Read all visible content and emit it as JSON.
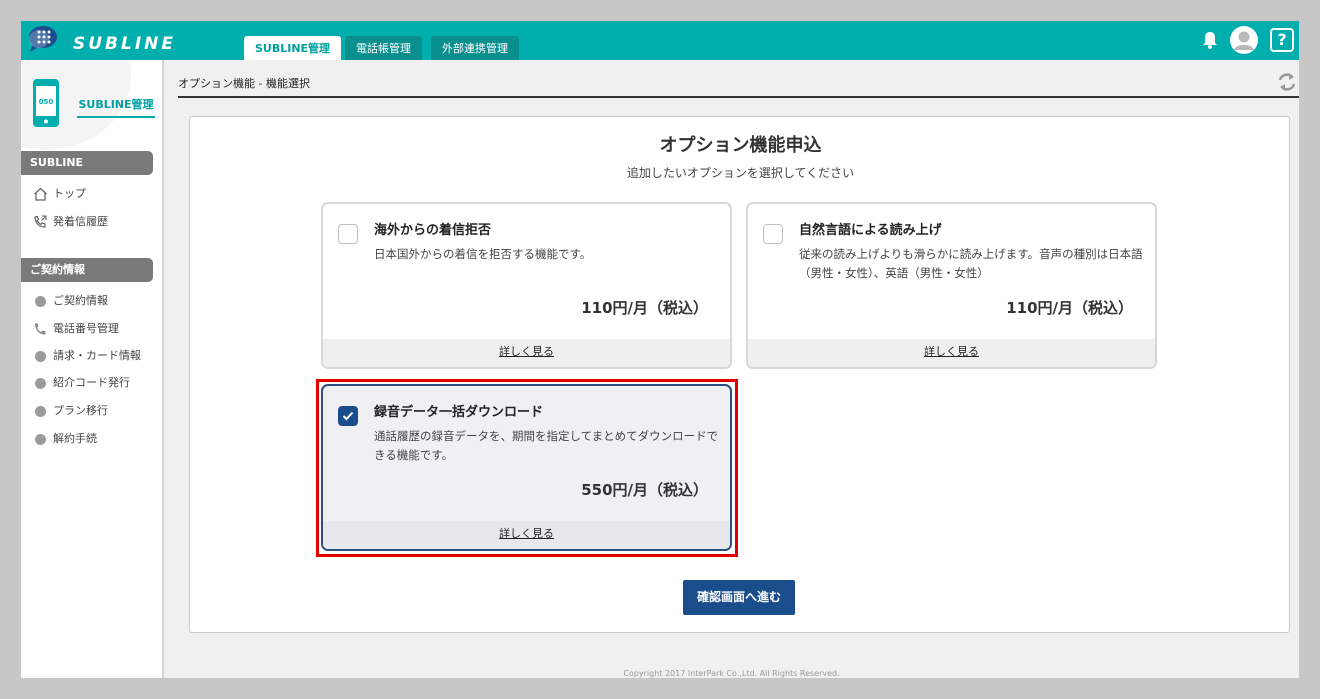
{
  "header": {
    "brand": "SUBLINE",
    "tabs": [
      {
        "label": "SUBLINE管理",
        "active": true
      },
      {
        "label": "電話帳管理",
        "active": false
      },
      {
        "label": "外部連携管理",
        "active": false
      }
    ],
    "help_label": "?"
  },
  "sidebar": {
    "phone_number_label": "050",
    "title": "SUBLINE管理",
    "sections": [
      {
        "label": "SUBLINE",
        "items": [
          {
            "label": "トップ",
            "icon": "home-icon"
          },
          {
            "label": "発着信履歴",
            "icon": "call-history-icon"
          }
        ]
      },
      {
        "label": "ご契約情報",
        "items": [
          {
            "label": "ご契約情報",
            "icon": "bullet-icon"
          },
          {
            "label": "電話番号管理",
            "icon": "phone-icon"
          },
          {
            "label": "請求・カード情報",
            "icon": "bullet-icon"
          },
          {
            "label": "紹介コード発行",
            "icon": "bullet-icon"
          },
          {
            "label": "プラン移行",
            "icon": "bullet-icon"
          },
          {
            "label": "解約手続",
            "icon": "bullet-icon"
          }
        ]
      }
    ]
  },
  "breadcrumb": "オプション機能 - 機能選択",
  "main": {
    "title": "オプション機能申込",
    "subtitle": "追加したいオプションを選択してください",
    "options": [
      {
        "title": "海外からの着信拒否",
        "description": "日本国外からの着信を拒否する機能です。",
        "price": "110円/月（税込）",
        "more_label": "詳しく見る",
        "checked": false
      },
      {
        "title": "自然言語による読み上げ",
        "description": "従来の読み上げよりも滑らかに読み上げます。音声の種別は日本語（男性・女性）、英語（男性・女性）",
        "price": "110円/月（税込）",
        "more_label": "詳しく見る",
        "checked": false
      },
      {
        "title": "録音データ一括ダウンロード",
        "description": "通話履歴の録音データを、期間を指定してまとめてダウンロードできる機能です。",
        "price": "550円/月（税込）",
        "more_label": "詳しく見る",
        "checked": true
      }
    ],
    "confirm_label": "確認画面へ進む"
  },
  "footer": {
    "copyright": "Copyright 2017 InterPark Co.,Ltd. All Rights Reserved."
  },
  "colors": {
    "brand_teal": "#00aeae",
    "primary_blue": "#1a4d8c",
    "highlight_red": "#e00000"
  }
}
